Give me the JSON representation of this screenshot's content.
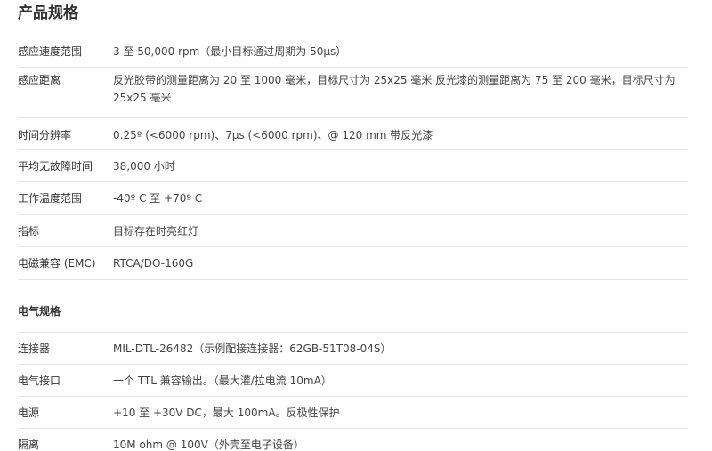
{
  "product_specs": {
    "title": "产品规格",
    "rows": [
      {
        "label": "感应速度范围",
        "value": "3 至 50,000 rpm（最小目标通过周期为 50μs）"
      },
      {
        "label": "感应距离",
        "value": "反光胶带的测量距离为 20 至 1000 毫米，目标尺寸为 25x25 毫米 反光漆的测量距离为 75 至 200 毫米，目标尺寸为 25x25 毫米"
      },
      {
        "label": "时间分辨率",
        "value": "0.25º (<6000 rpm)、7μs (<6000 rpm)、@ 120 mm 带反光漆"
      },
      {
        "label": "平均无故障时间",
        "value": "38,000 小时"
      },
      {
        "label": "工作温度范围",
        "value": " -40º C 至 +70º C"
      },
      {
        "label": "指标",
        "value": "目标存在时亮红灯"
      },
      {
        "label": "电磁兼容 (EMC)",
        "value": "RTCA/DO-160G"
      }
    ]
  },
  "electrical_specs": {
    "title": "电气规格",
    "rows": [
      {
        "label": "连接器",
        "value": "MIL-DTL-26482（示例配接连接器：62GB-51T08-04S）"
      },
      {
        "label": "电气接口",
        "value": "一个 TTL 兼容输出。（最大灌/拉电流 10mA）"
      },
      {
        "label": "电源",
        "value": "+10 至 +30V DC，最大 100mA。反极性保护"
      },
      {
        "label": "隔离",
        "value": "10M ohm @ 100V（外壳至电子设备）"
      }
    ]
  }
}
